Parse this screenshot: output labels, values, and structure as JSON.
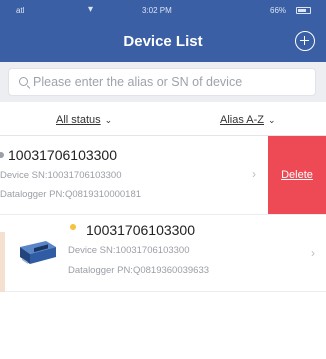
{
  "status_bar": {
    "carrier": "atl",
    "time": "3:02 PM",
    "battery": "66%"
  },
  "header": {
    "title": "Device List"
  },
  "search": {
    "placeholder": "Please enter the alias or SN of device"
  },
  "filters": {
    "status_label": "All status",
    "sort_label": "Alias A-Z"
  },
  "devices": [
    {
      "alias": "10031706103300",
      "sn": "Device SN:10031706103300",
      "pn": "Datalogger PN:Q0819310000181",
      "status_color": "#9aa0aa",
      "action_label": "Delete"
    },
    {
      "alias": "10031706103300",
      "sn": "Device SN:10031706103300",
      "pn": "Datalogger PN:Q0819360039633",
      "status_color": "#f5c23a"
    }
  ],
  "colors": {
    "header": "#3a5fa4",
    "delete": "#ee4a56"
  }
}
